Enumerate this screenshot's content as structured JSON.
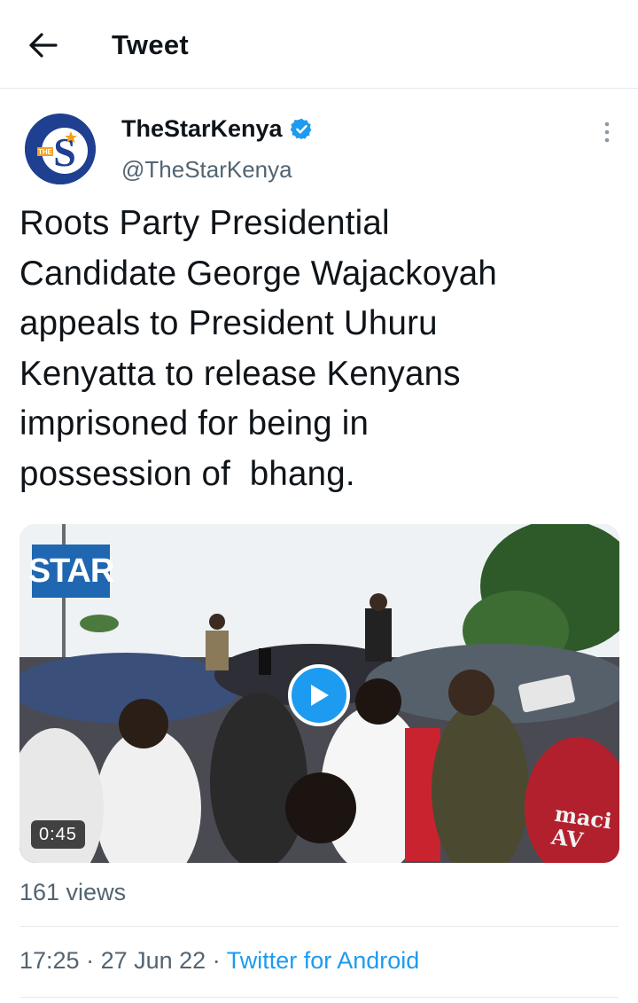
{
  "header": {
    "title": "Tweet",
    "back_icon": "arrow-left-icon"
  },
  "author": {
    "display_name": "TheStarKenya",
    "handle": "@TheStarKenya",
    "verified": true,
    "avatar_letter": "S",
    "avatar_tag": "THE"
  },
  "more_icon": "vertical-dots-icon",
  "tweet": {
    "text": "Roots Party Presidential\nCandidate George Wajackoyah\nappeals to President Uhuru\nKenyatta to release Kenyans\nimprisoned for being in\npossession of  bhang."
  },
  "media": {
    "type": "video",
    "logo_text": "STAR",
    "duration": "0:45",
    "corner_text": "maci\nAV",
    "play_icon": "play-icon"
  },
  "stats": {
    "views": "161 views"
  },
  "meta": {
    "time": "17:25",
    "sep1": " · ",
    "date": "27 Jun 22",
    "sep2": " · ",
    "source": "Twitter for Android"
  },
  "colors": {
    "accent": "#1d9bf0",
    "text_primary": "#0f1419",
    "text_secondary": "#536471",
    "divider": "#e6e9ec",
    "avatar_bg": "#1f3f91",
    "logo_bg": "#1f67b1"
  }
}
